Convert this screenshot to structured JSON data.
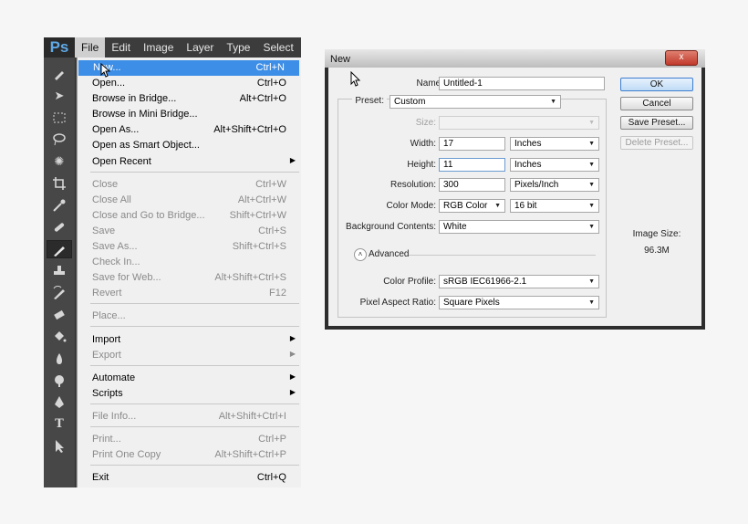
{
  "photoshop": {
    "logo": "Ps",
    "menubar": [
      "File",
      "Edit",
      "Image",
      "Layer",
      "Type",
      "Select",
      "F"
    ],
    "file_menu": [
      {
        "label": "New...",
        "shortcut": "Ctrl+N",
        "highlighted": true
      },
      {
        "label": "Open...",
        "shortcut": "Ctrl+O"
      },
      {
        "label": "Browse in Bridge...",
        "shortcut": "Alt+Ctrl+O"
      },
      {
        "label": "Browse in Mini Bridge...",
        "shortcut": ""
      },
      {
        "label": "Open As...",
        "shortcut": "Alt+Shift+Ctrl+O"
      },
      {
        "label": "Open as Smart Object...",
        "shortcut": ""
      },
      {
        "label": "Open Recent",
        "shortcut": "",
        "submenu": true
      },
      {
        "label": "Close",
        "shortcut": "Ctrl+W",
        "disabled": true
      },
      {
        "label": "Close All",
        "shortcut": "Alt+Ctrl+W",
        "disabled": true
      },
      {
        "label": "Close and Go to Bridge...",
        "shortcut": "Shift+Ctrl+W",
        "disabled": true
      },
      {
        "label": "Save",
        "shortcut": "Ctrl+S",
        "disabled": true
      },
      {
        "label": "Save As...",
        "shortcut": "Shift+Ctrl+S",
        "disabled": true
      },
      {
        "label": "Check In...",
        "shortcut": "",
        "disabled": true
      },
      {
        "label": "Save for Web...",
        "shortcut": "Alt+Shift+Ctrl+S",
        "disabled": true
      },
      {
        "label": "Revert",
        "shortcut": "F12",
        "disabled": true
      },
      {
        "label": "Place...",
        "shortcut": "",
        "disabled": true
      },
      {
        "label": "Import",
        "shortcut": "",
        "submenu": true
      },
      {
        "label": "Export",
        "shortcut": "",
        "submenu": true,
        "disabled": true
      },
      {
        "label": "Automate",
        "shortcut": "",
        "submenu": true
      },
      {
        "label": "Scripts",
        "shortcut": "",
        "submenu": true
      },
      {
        "label": "File Info...",
        "shortcut": "Alt+Shift+Ctrl+I",
        "disabled": true
      },
      {
        "label": "Print...",
        "shortcut": "Ctrl+P",
        "disabled": true
      },
      {
        "label": "Print One Copy",
        "shortcut": "Alt+Shift+Ctrl+P",
        "disabled": true
      },
      {
        "label": "Exit",
        "shortcut": "Ctrl+Q"
      }
    ],
    "tools": [
      "brush-icon",
      "move-icon",
      "marquee-icon",
      "lasso-icon",
      "magic-wand-icon",
      "crop-icon",
      "eyedropper-icon",
      "healing-icon",
      "brush-tool-icon",
      "stamp-icon",
      "history-brush-icon",
      "eraser-icon",
      "bucket-icon",
      "blur-icon",
      "dodge-icon",
      "pen-icon",
      "type-icon",
      "path-select-icon"
    ]
  },
  "dialog": {
    "title": "New",
    "close": "x",
    "fields": {
      "name_label": "Name:",
      "name_value": "Untitled-1",
      "preset_label": "Preset:",
      "preset_value": "Custom",
      "size_label": "Size:",
      "size_value": "",
      "width_label": "Width:",
      "width_value": "17",
      "width_unit": "Inches",
      "height_label": "Height:",
      "height_value": "11",
      "height_unit": "Inches",
      "resolution_label": "Resolution:",
      "resolution_value": "300",
      "resolution_unit": "Pixels/Inch",
      "colormode_label": "Color Mode:",
      "colormode_value": "RGB Color",
      "bitdepth_value": "16 bit",
      "bg_label": "Background Contents:",
      "bg_value": "White",
      "advanced_label": "Advanced",
      "profile_label": "Color Profile:",
      "profile_value": "sRGB IEC61966-2.1",
      "aspect_label": "Pixel Aspect Ratio:",
      "aspect_value": "Square Pixels"
    },
    "buttons": {
      "ok": "OK",
      "cancel": "Cancel",
      "save_preset": "Save Preset...",
      "delete_preset": "Delete Preset..."
    },
    "image_size_label": "Image Size:",
    "image_size_value": "96.3M"
  }
}
